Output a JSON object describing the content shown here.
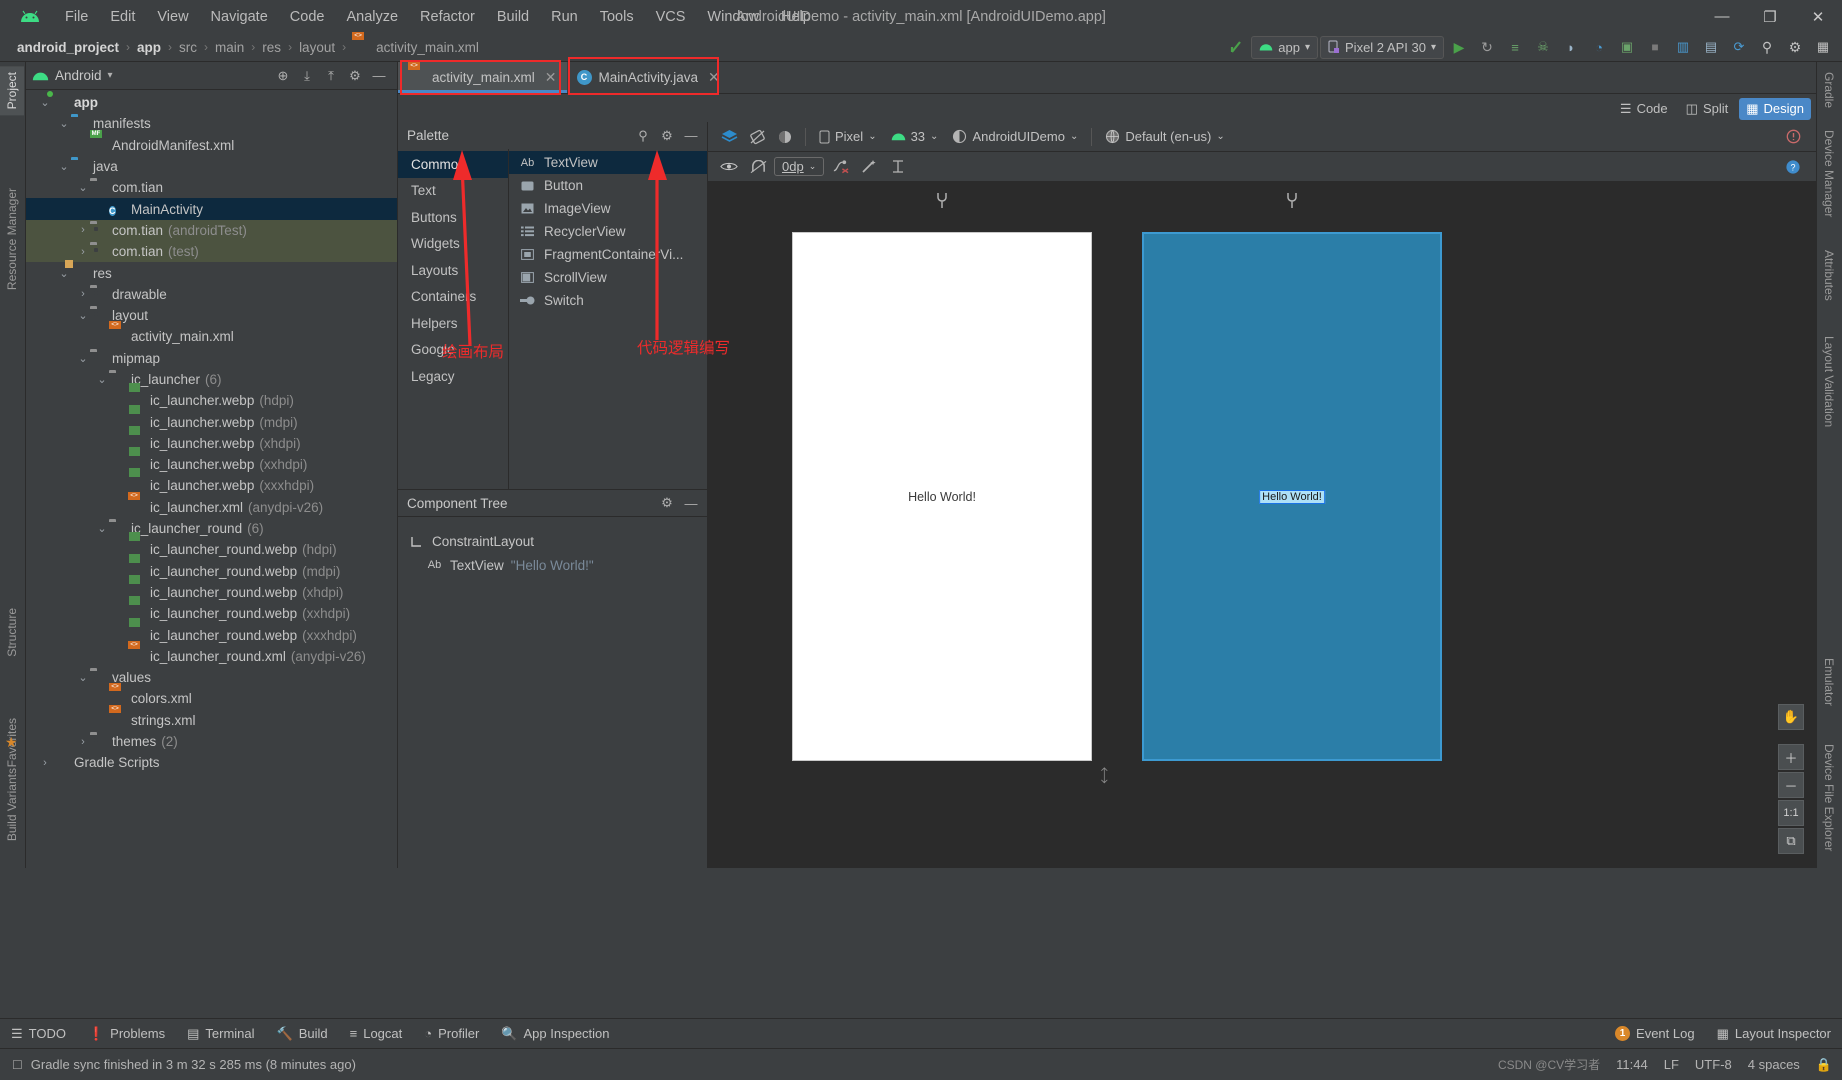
{
  "window": {
    "title": "AndroidUIDemo - activity_main.xml [AndroidUIDemo.app]",
    "minimize": "—",
    "maximize": "❐",
    "close": "✕"
  },
  "menubar": {
    "logo_name": "android-logo-icon",
    "items": [
      {
        "label": "File"
      },
      {
        "label": "Edit"
      },
      {
        "label": "View"
      },
      {
        "label": "Navigate"
      },
      {
        "label": "Code"
      },
      {
        "label": "Analyze"
      },
      {
        "label": "Refactor"
      },
      {
        "label": "Build"
      },
      {
        "label": "Run"
      },
      {
        "label": "Tools"
      },
      {
        "label": "VCS"
      },
      {
        "label": "Window"
      },
      {
        "label": "Help"
      }
    ]
  },
  "breadcrumb": {
    "items": [
      "android_project",
      "app",
      "src",
      "main",
      "res",
      "layout",
      "activity_main.xml"
    ],
    "separator": "›"
  },
  "run_toolbar": {
    "module_chip": "app",
    "device_chip": "Pixel 2 API 30",
    "chevron": "▾",
    "buttons": [
      {
        "name": "run-button",
        "glyph": "▶",
        "color": "#4aa14a"
      },
      {
        "name": "apply-changes-button",
        "glyph": "↻",
        "color": "#b4b4b4"
      },
      {
        "name": "apply-code-changes-button",
        "glyph": "≡",
        "color": "#6aa36a"
      },
      {
        "name": "debug-button",
        "glyph": "☠",
        "color": "#6aa36a"
      },
      {
        "name": "attach-debugger-button",
        "glyph": "◗",
        "color": "#9ab4c8"
      },
      {
        "name": "profiler-button",
        "glyph": "◔",
        "color": "#4a9ad1"
      },
      {
        "name": "device-manager-button",
        "glyph": "▣",
        "color": "#6aa36a"
      },
      {
        "name": "stop-button",
        "glyph": "■",
        "color": "#8a8a8a"
      },
      {
        "name": "sdk-manager-button",
        "glyph": "▥",
        "color": "#4a9ad1"
      },
      {
        "name": "avd-manager-button",
        "glyph": "▤",
        "color": "#9ab4c8"
      },
      {
        "name": "sync-gradle-button",
        "glyph": "⟳",
        "color": "#4a9ad1"
      },
      {
        "name": "search-everywhere-button",
        "glyph": "⚲",
        "color": "#c0c0c0"
      },
      {
        "name": "settings-button",
        "glyph": "⚙",
        "color": "#c0c0c0"
      },
      {
        "name": "project-structure-button",
        "glyph": "▦",
        "color": "#c0c0c0"
      }
    ]
  },
  "left_strip": {
    "tabs": [
      {
        "label": "Project",
        "active": true
      },
      {
        "label": "Structure",
        "active": false
      },
      {
        "label": "Favorites",
        "active": false
      },
      {
        "label": "Build Variants",
        "active": false
      }
    ]
  },
  "right_strip": {
    "tabs": [
      {
        "label": "Gradle"
      },
      {
        "label": "Device Manager"
      },
      {
        "label": "Resource Manager"
      },
      {
        "label": "Attributes"
      },
      {
        "label": "Layout Validation"
      },
      {
        "label": "Emulator"
      },
      {
        "label": "Device File Explorer"
      }
    ]
  },
  "project_panel": {
    "title": "Android",
    "chevron": "▾",
    "head_buttons": [
      {
        "name": "select-opened-file-button",
        "glyph": "⊕"
      },
      {
        "name": "expand-all-button",
        "glyph": "⤓"
      },
      {
        "name": "collapse-all-button",
        "glyph": "⤒"
      },
      {
        "name": "panel-settings-button",
        "glyph": "⚙"
      },
      {
        "name": "hide-panel-button",
        "glyph": "—"
      }
    ],
    "tree": [
      {
        "indent": 0,
        "arrow": "⌄",
        "icon": "module-icon",
        "label": "app",
        "suffix": "",
        "bold": true,
        "state": ""
      },
      {
        "indent": 1,
        "arrow": "⌄",
        "icon": "folder-icon",
        "label": "manifests",
        "suffix": "",
        "bold": false,
        "state": ""
      },
      {
        "indent": 2,
        "arrow": "",
        "icon": "manifest-file-icon",
        "label": "AndroidManifest.xml",
        "suffix": "",
        "bold": false,
        "state": ""
      },
      {
        "indent": 1,
        "arrow": "⌄",
        "icon": "folder-icon",
        "label": "java",
        "suffix": "",
        "bold": false,
        "state": ""
      },
      {
        "indent": 2,
        "arrow": "⌄",
        "icon": "package-icon",
        "label": "com.tian",
        "suffix": "",
        "bold": false,
        "state": ""
      },
      {
        "indent": 3,
        "arrow": "",
        "icon": "java-class-icon",
        "label": "MainActivity",
        "suffix": "",
        "bold": false,
        "state": "selected"
      },
      {
        "indent": 2,
        "arrow": "›",
        "icon": "package-icon",
        "label": "com.tian",
        "suffix": "(androidTest)",
        "bold": false,
        "state": "test"
      },
      {
        "indent": 2,
        "arrow": "›",
        "icon": "package-icon",
        "label": "com.tian",
        "suffix": "(test)",
        "bold": false,
        "state": "test"
      },
      {
        "indent": 1,
        "arrow": "⌄",
        "icon": "res-folder-icon",
        "label": "res",
        "suffix": "",
        "bold": false,
        "state": ""
      },
      {
        "indent": 2,
        "arrow": "›",
        "icon": "package-icon",
        "label": "drawable",
        "suffix": "",
        "bold": false,
        "state": ""
      },
      {
        "indent": 2,
        "arrow": "⌄",
        "icon": "package-icon",
        "label": "layout",
        "suffix": "",
        "bold": false,
        "state": ""
      },
      {
        "indent": 3,
        "arrow": "",
        "icon": "xml-file-icon",
        "label": "activity_main.xml",
        "suffix": "",
        "bold": false,
        "state": ""
      },
      {
        "indent": 2,
        "arrow": "⌄",
        "icon": "package-icon",
        "label": "mipmap",
        "suffix": "",
        "bold": false,
        "state": ""
      },
      {
        "indent": 3,
        "arrow": "⌄",
        "icon": "package-icon",
        "label": "ic_launcher",
        "suffix": "(6)",
        "bold": false,
        "state": ""
      },
      {
        "indent": 4,
        "arrow": "",
        "icon": "image-file-icon",
        "label": "ic_launcher.webp",
        "suffix": "(hdpi)",
        "bold": false,
        "state": ""
      },
      {
        "indent": 4,
        "arrow": "",
        "icon": "image-file-icon",
        "label": "ic_launcher.webp",
        "suffix": "(mdpi)",
        "bold": false,
        "state": ""
      },
      {
        "indent": 4,
        "arrow": "",
        "icon": "image-file-icon",
        "label": "ic_launcher.webp",
        "suffix": "(xhdpi)",
        "bold": false,
        "state": ""
      },
      {
        "indent": 4,
        "arrow": "",
        "icon": "image-file-icon",
        "label": "ic_launcher.webp",
        "suffix": "(xxhdpi)",
        "bold": false,
        "state": ""
      },
      {
        "indent": 4,
        "arrow": "",
        "icon": "image-file-icon",
        "label": "ic_launcher.webp",
        "suffix": "(xxxhdpi)",
        "bold": false,
        "state": ""
      },
      {
        "indent": 4,
        "arrow": "",
        "icon": "xml-file-icon",
        "label": "ic_launcher.xml",
        "suffix": "(anydpi-v26)",
        "bold": false,
        "state": ""
      },
      {
        "indent": 3,
        "arrow": "⌄",
        "icon": "package-icon",
        "label": "ic_launcher_round",
        "suffix": "(6)",
        "bold": false,
        "state": ""
      },
      {
        "indent": 4,
        "arrow": "",
        "icon": "image-file-icon",
        "label": "ic_launcher_round.webp",
        "suffix": "(hdpi)",
        "bold": false,
        "state": ""
      },
      {
        "indent": 4,
        "arrow": "",
        "icon": "image-file-icon",
        "label": "ic_launcher_round.webp",
        "suffix": "(mdpi)",
        "bold": false,
        "state": ""
      },
      {
        "indent": 4,
        "arrow": "",
        "icon": "image-file-icon",
        "label": "ic_launcher_round.webp",
        "suffix": "(xhdpi)",
        "bold": false,
        "state": ""
      },
      {
        "indent": 4,
        "arrow": "",
        "icon": "image-file-icon",
        "label": "ic_launcher_round.webp",
        "suffix": "(xxhdpi)",
        "bold": false,
        "state": ""
      },
      {
        "indent": 4,
        "arrow": "",
        "icon": "image-file-icon",
        "label": "ic_launcher_round.webp",
        "suffix": "(xxxhdpi)",
        "bold": false,
        "state": ""
      },
      {
        "indent": 4,
        "arrow": "",
        "icon": "xml-file-icon",
        "label": "ic_launcher_round.xml",
        "suffix": "(anydpi-v26)",
        "bold": false,
        "state": ""
      },
      {
        "indent": 2,
        "arrow": "⌄",
        "icon": "package-icon",
        "label": "values",
        "suffix": "",
        "bold": false,
        "state": ""
      },
      {
        "indent": 3,
        "arrow": "",
        "icon": "xml-file-icon",
        "label": "colors.xml",
        "suffix": "",
        "bold": false,
        "state": ""
      },
      {
        "indent": 3,
        "arrow": "",
        "icon": "xml-file-icon",
        "label": "strings.xml",
        "suffix": "",
        "bold": false,
        "state": ""
      },
      {
        "indent": 2,
        "arrow": "›",
        "icon": "package-icon",
        "label": "themes",
        "suffix": "(2)",
        "bold": false,
        "state": ""
      },
      {
        "indent": 0,
        "arrow": "›",
        "icon": "gradle-icon",
        "label": "Gradle Scripts",
        "suffix": "",
        "bold": false,
        "state": ""
      }
    ]
  },
  "editor_tabs": [
    {
      "label": "activity_main.xml",
      "icon": "xml-file-icon",
      "active": true,
      "close": "✕"
    },
    {
      "label": "MainActivity.java",
      "icon": "java-class-icon",
      "active": false,
      "close": "✕"
    }
  ],
  "view_modes": [
    {
      "label": "Code",
      "icon": "code-icon",
      "active": false
    },
    {
      "label": "Split",
      "icon": "split-icon",
      "active": false
    },
    {
      "label": "Design",
      "icon": "design-icon",
      "active": true
    }
  ],
  "palette": {
    "title": "Palette",
    "search_icon": "search-icon",
    "settings_icon": "gear-icon",
    "hide_icon": "minus-icon",
    "categories": [
      {
        "label": "Common",
        "active": true
      },
      {
        "label": "Text",
        "active": false
      },
      {
        "label": "Buttons",
        "active": false
      },
      {
        "label": "Widgets",
        "active": false
      },
      {
        "label": "Layouts",
        "active": false
      },
      {
        "label": "Containers",
        "active": false
      },
      {
        "label": "Helpers",
        "active": false
      },
      {
        "label": "Google",
        "active": false
      },
      {
        "label": "Legacy",
        "active": false
      }
    ],
    "items": [
      {
        "label": "TextView",
        "icon": "textview-icon",
        "glyph": "Ab",
        "active": true
      },
      {
        "label": "Button",
        "icon": "button-icon",
        "glyph": "▬",
        "active": false
      },
      {
        "label": "ImageView",
        "icon": "imageview-icon",
        "glyph": "⛰",
        "active": false
      },
      {
        "label": "RecyclerView",
        "icon": "recyclerview-icon",
        "glyph": "☰",
        "active": false
      },
      {
        "label": "FragmentContainerVi...",
        "icon": "fragment-icon",
        "glyph": "▣",
        "active": false
      },
      {
        "label": "ScrollView",
        "icon": "scrollview-icon",
        "glyph": "▧",
        "active": false
      },
      {
        "label": "Switch",
        "icon": "switch-icon",
        "glyph": "●",
        "active": false
      }
    ]
  },
  "component_tree": {
    "title": "Component Tree",
    "settings_icon": "gear-icon",
    "hide_icon": "minus-icon",
    "rows": [
      {
        "icon": "constraint-layout-icon",
        "glyph": "⌐",
        "label": "ConstraintLayout",
        "value": "",
        "indent": 0
      },
      {
        "icon": "textview-icon",
        "glyph": "Ab",
        "label": "TextView",
        "value": "\"Hello World!\"",
        "indent": 1
      }
    ]
  },
  "design_toolbar": {
    "row1": [
      {
        "name": "design-surface-mode-button",
        "label": "",
        "icon": "layers-icon"
      },
      {
        "name": "orientation-button",
        "label": "",
        "icon": "rotate-icon"
      },
      {
        "name": "theme-button",
        "label": "",
        "icon": "theme-icon"
      },
      {
        "name": "device-selector",
        "label": "Pixel",
        "icon": "phone-icon"
      },
      {
        "name": "api-selector",
        "label": "33",
        "icon": "android-icon"
      },
      {
        "name": "theme-selector",
        "label": "AndroidUIDemo",
        "icon": "contrast-icon"
      },
      {
        "name": "locale-selector",
        "label": "Default (en-us)",
        "icon": "globe-icon"
      }
    ],
    "chevron": "⌄",
    "warning_icon": "warning-icon",
    "row2": [
      {
        "name": "show-constraints-button",
        "icon": "eye-icon"
      },
      {
        "name": "autoconnect-button",
        "icon": "magnet-off-icon"
      },
      {
        "name": "default-margin-value",
        "label": "0dp"
      },
      {
        "name": "clear-constraints-button",
        "icon": "clear-constraints-icon"
      },
      {
        "name": "infer-constraints-button",
        "icon": "magic-wand-icon"
      },
      {
        "name": "baseline-guidelines-button",
        "icon": "guidelines-icon"
      }
    ],
    "help_icon": "help-icon"
  },
  "canvas": {
    "preview_device": {
      "name": "design-preview",
      "hello_text": "Hello World!"
    },
    "blueprint_device": {
      "name": "blueprint-preview",
      "hello_text": "Hello World!"
    },
    "pin_icon": "pin-icon",
    "resize_handle": "⤡",
    "zoom_controls": [
      {
        "name": "pan-tool-button",
        "glyph": "✋"
      },
      {
        "name": "zoom-in-button",
        "glyph": "＋"
      },
      {
        "name": "zoom-out-button",
        "glyph": "－"
      },
      {
        "name": "zoom-actual-size-button",
        "glyph": "1:1"
      },
      {
        "name": "zoom-to-fit-button",
        "glyph": "⧉"
      }
    ]
  },
  "annotations": [
    {
      "text": "绘画布局",
      "name": "annotation-draw-layout"
    },
    {
      "text": "代码逻辑编写",
      "name": "annotation-code-logic"
    }
  ],
  "bottom_tool_windows": [
    {
      "label": "TODO",
      "icon": "todo-icon",
      "glyph": "☰"
    },
    {
      "label": "Problems",
      "icon": "problems-icon",
      "glyph": "❗"
    },
    {
      "label": "Terminal",
      "icon": "terminal-icon",
      "glyph": "▤"
    },
    {
      "label": "Build",
      "icon": "build-icon",
      "glyph": "🔨"
    },
    {
      "label": "Logcat",
      "icon": "logcat-icon",
      "glyph": "≡"
    },
    {
      "label": "Profiler",
      "icon": "profiler-icon",
      "glyph": "◔"
    },
    {
      "label": "App Inspection",
      "icon": "app-inspection-icon",
      "glyph": "🔍"
    }
  ],
  "status_bar": {
    "message_icon": "info-icon",
    "message": "Gradle sync finished in 3 m 32 s 285 ms (8 minutes ago)",
    "event_log": {
      "label": "Event Log",
      "count": "1"
    },
    "layout_inspector": {
      "label": "Layout Inspector",
      "icon": "layout-inspector-icon"
    },
    "time": "11:44",
    "line_separator": "LF",
    "encoding": "UTF-8",
    "indent": "4 spaces",
    "lock_icon": "lock-icon",
    "watermark": "CSDN @CV学习者"
  },
  "colors": {
    "accent_blue": "#4a88c7",
    "selection_blue": "#0d293e",
    "test_green": "#4c5340",
    "annotation_red": "#ee2b2b",
    "blueprint_blue": "#2b7ea8",
    "panel_bg": "#3c3f41",
    "canvas_bg": "#2b2b2b"
  }
}
